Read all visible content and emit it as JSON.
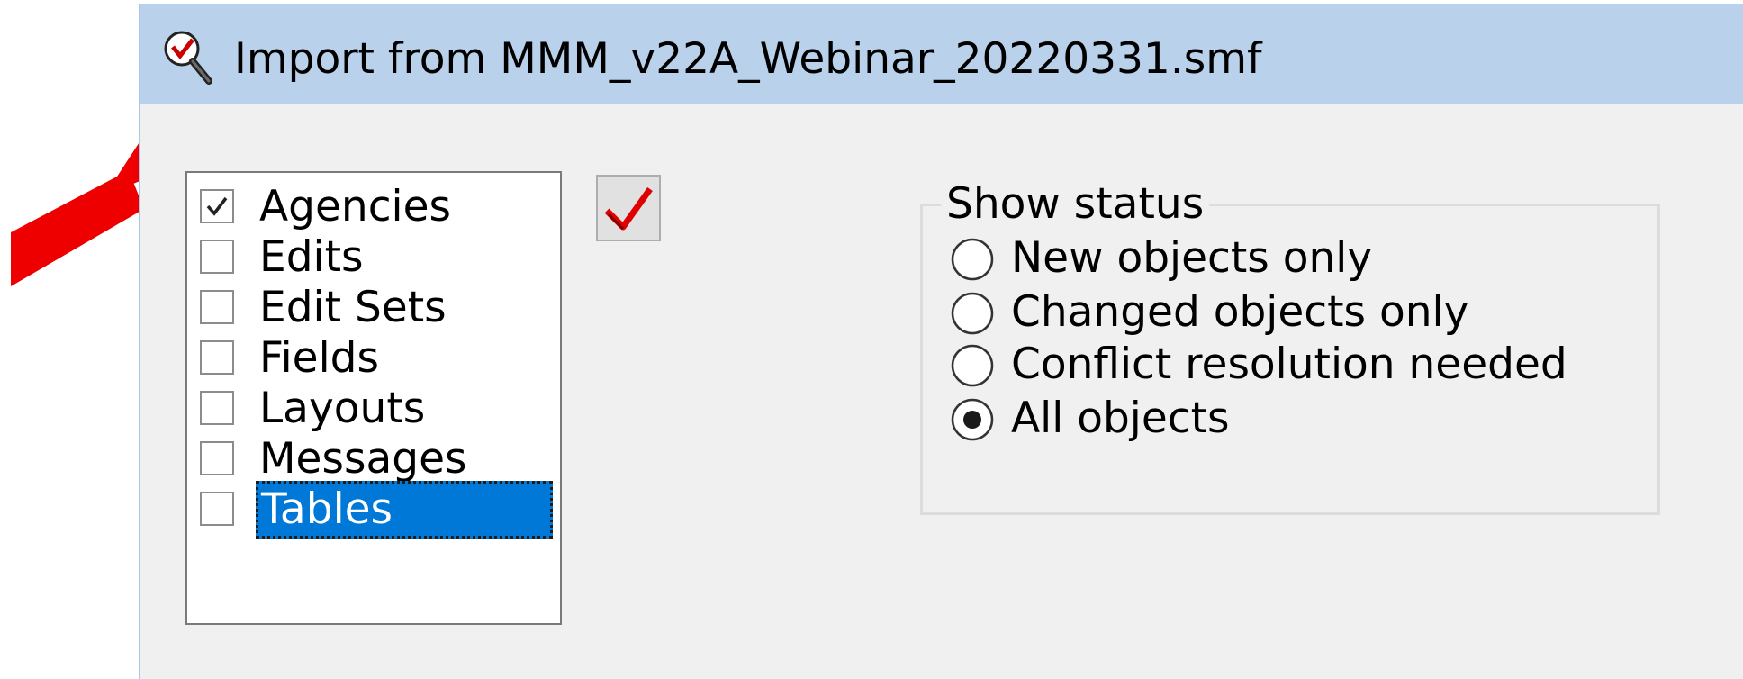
{
  "window": {
    "title": "Import from MMM_v22A_Webinar_20220331.smf"
  },
  "object_types": {
    "items": [
      {
        "label": "Agencies",
        "checked": true,
        "selected": false
      },
      {
        "label": "Edits",
        "checked": false,
        "selected": false
      },
      {
        "label": "Edit Sets",
        "checked": false,
        "selected": false
      },
      {
        "label": "Fields",
        "checked": false,
        "selected": false
      },
      {
        "label": "Layouts",
        "checked": false,
        "selected": false
      },
      {
        "label": "Messages",
        "checked": false,
        "selected": false
      },
      {
        "label": "Tables",
        "checked": false,
        "selected": true
      }
    ]
  },
  "check_all_button": {
    "icon": "red-checkmark-icon"
  },
  "show_status": {
    "legend": "Show status",
    "options": [
      {
        "label": "New objects only",
        "selected": false
      },
      {
        "label": "Changed objects only",
        "selected": false
      },
      {
        "label": "Conflict resolution needed",
        "selected": false
      },
      {
        "label": "All objects",
        "selected": true
      }
    ]
  },
  "annotation": {
    "icon": "red-arrow-icon",
    "color": "#ee0000"
  },
  "colors": {
    "selection": "#0078d7",
    "titlebar": "#b9d1ea",
    "window": "#f0f0f0"
  }
}
